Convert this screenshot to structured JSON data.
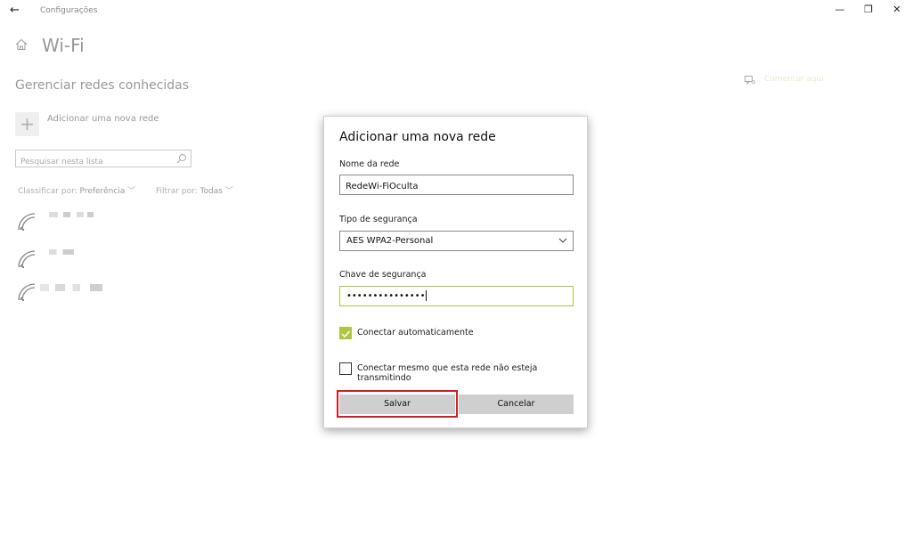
{
  "window": {
    "back_glyph": "←",
    "title": "Configurações",
    "minimize_glyph": "—",
    "maximize_glyph": "❐",
    "close_glyph": "✕"
  },
  "page": {
    "title": "Wi-Fi",
    "section_title": "Gerenciar redes conhecidas",
    "add_network_label": "Adicionar uma nova rede",
    "search_placeholder": "Pesquisar nesta lista",
    "sort_prefix": "Classificar por:",
    "sort_value": "Preferência",
    "filter_prefix": "Filtrar por:",
    "filter_value": "Todas",
    "feedback_link": "Comentar aqui"
  },
  "icons": {
    "back": "back-arrow-icon",
    "home": "home-icon",
    "add": "plus-icon",
    "search": "search-icon",
    "wifi": "wifi-icon",
    "feedback": "feedback-icon",
    "chevron": "chevron-down-icon",
    "check": "checkmark-icon"
  },
  "networks": [
    {
      "name_hidden": true
    },
    {
      "name_hidden": true
    },
    {
      "name_hidden": true
    }
  ],
  "dialog": {
    "title": "Adicionar uma nova rede",
    "network_name_label": "Nome da rede",
    "network_name_value": "RedeWi-FiOculta",
    "security_type_label": "Tipo de segurança",
    "security_type_value": "AES WPA2-Personal",
    "security_key_label": "Chave de segurança",
    "security_key_masked": "•••••••••••••••",
    "auto_connect_label": "Conectar automaticamente",
    "auto_connect_checked": true,
    "hidden_connect_label": "Conectar mesmo que esta rede não esteja transmitindo",
    "hidden_connect_checked": false,
    "save_label": "Salvar",
    "cancel_label": "Cancelar"
  },
  "colors": {
    "accent": "#b2c540",
    "highlight": "#d11f26",
    "button_bg": "#cfcfcf",
    "muted_text": "#9a9a9a"
  }
}
